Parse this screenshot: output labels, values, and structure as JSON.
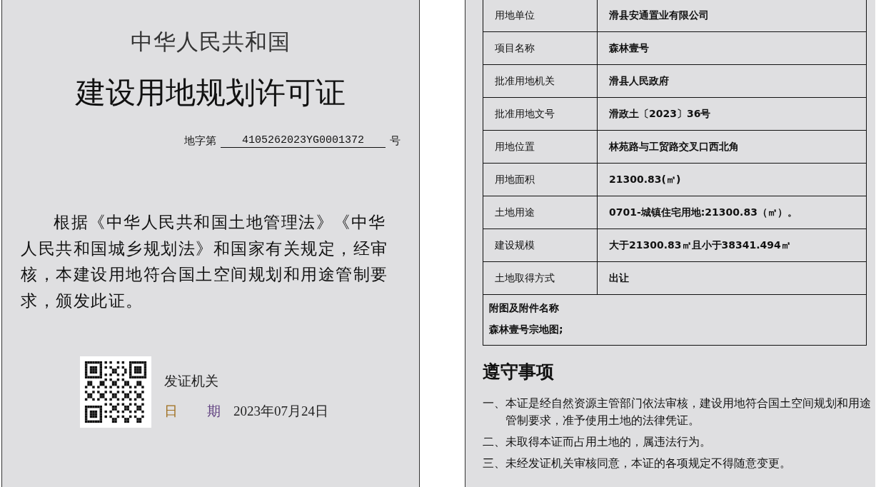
{
  "certificate": {
    "country": "中华人民共和国",
    "title": "建设用地规划许可证",
    "number_prefix": "地字第",
    "number": "4105262023YG0001372",
    "number_suffix": "号",
    "body": "根据《中华人民共和国土地管理法》《中华人民共和国城乡规划法》和国家有关规定，经审核，本建设用地符合国土空间规划和用途管制要求，颁发此证。",
    "issuer_label": "发证机关",
    "date_label_1": "日",
    "date_label_2": "期",
    "date": "2023年07月24日"
  },
  "details": {
    "rows": [
      {
        "label": "用地单位",
        "value": "滑县安通置业有限公司"
      },
      {
        "label": "项目名称",
        "value": "森林壹号"
      },
      {
        "label": "批准用地机关",
        "value": "滑县人民政府"
      },
      {
        "label": "批准用地文号",
        "value": "滑政土〔2023〕36号"
      },
      {
        "label": "用地位置",
        "value": "林苑路与工贸路交叉口西北角"
      },
      {
        "label": "用地面积",
        "value": "21300.83(㎡)"
      },
      {
        "label": "土地用途",
        "value": "0701-城镇住宅用地:21300.83（㎡）。"
      },
      {
        "label": "建设规模",
        "value": "大于21300.83㎡且小于38341.494㎡"
      },
      {
        "label": "土地取得方式",
        "value": "出让"
      }
    ],
    "attachments_label": "附图及附件名称",
    "attachments": "森林壹号宗地图;"
  },
  "notices": {
    "title": "遵守事项",
    "items": [
      "一、本证是经自然资源主管部门依法审核，建设用地符合国土空间规划和用途管制要求，准予使用土地的法律凭证。",
      "二、未取得本证而占用土地的，属违法行为。",
      "三、未经发证机关审核同意，本证的各项规定不得随意变更。"
    ]
  }
}
